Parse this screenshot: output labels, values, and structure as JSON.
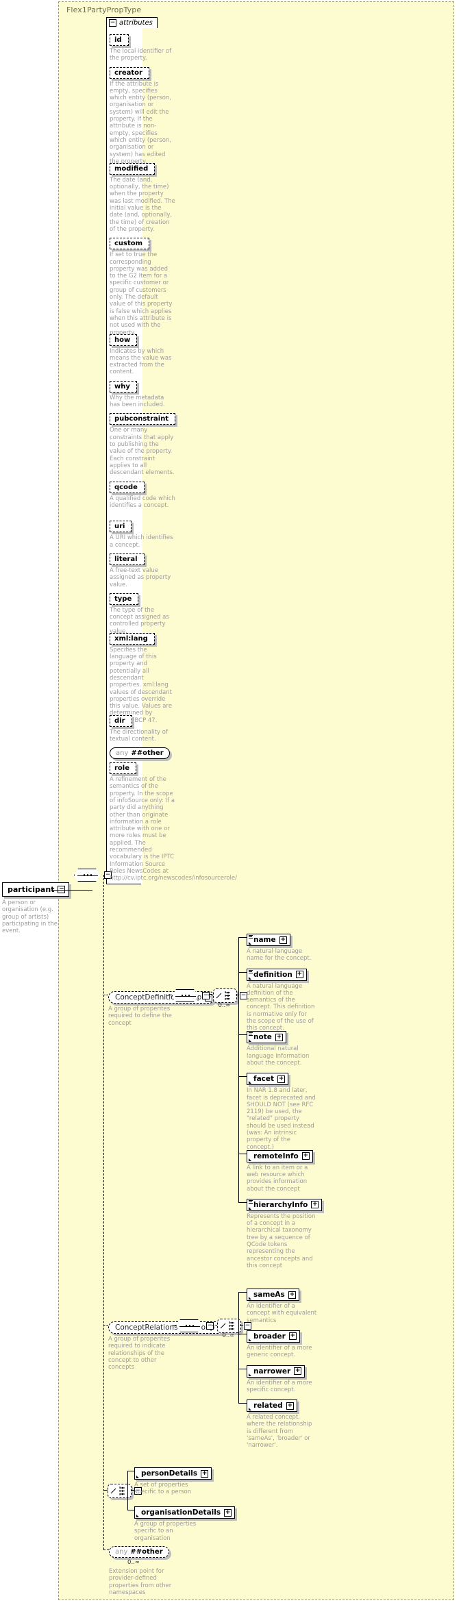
{
  "type": {
    "name": "Flex1PartyPropType",
    "attributes_label": "attributes",
    "collapse_icon": "minus-icon"
  },
  "attributes": [
    {
      "name": "id",
      "desc": "The local identifier of the property."
    },
    {
      "name": "creator",
      "desc": "If the attribute is empty, specifies which entity (person, organisation or system) will edit the property. If the attribute is non-empty, specifies which entity (person, organisation or system) has edited the property."
    },
    {
      "name": "modified",
      "desc": "The date (and, optionally, the time) when the property was last modified. The initial value is the date (and, optionally, the time) of creation of the property."
    },
    {
      "name": "custom",
      "desc": "If set to true the corresponding property was added to the G2 Item for a specific customer or group of customers only. The default value of this property is false which applies when this attribute is not used with the property."
    },
    {
      "name": "how",
      "desc": "Indicates by which means the value was extracted from the content."
    },
    {
      "name": "why",
      "desc": "Why the metadata has been included."
    },
    {
      "name": "pubconstraint",
      "desc": "One or many constraints that apply to publishing the value of the property. Each constraint applies to all descendant elements."
    },
    {
      "name": "qcode",
      "desc": "A qualified code which identifies a concept."
    },
    {
      "name": "uri",
      "desc": "A URI which identifies a concept."
    },
    {
      "name": "literal",
      "desc": "A free-text value assigned as property value."
    },
    {
      "name": "type",
      "desc": "The type of the concept assigned as controlled property value."
    },
    {
      "name": "xml:lang",
      "desc": "Specifies the language of this property and potentially all descendant properties. xml:lang values of descendant properties override this value. Values are determined by Internet BCP 47."
    },
    {
      "name": "dir",
      "desc": "The directionality of textual content."
    },
    {
      "name": "any ##other",
      "desc": "",
      "kind": "any",
      "any_prefix": "any",
      "any_value": "##other"
    },
    {
      "name": "role",
      "desc": "A refinement of the semantics of the property. In the scope of infoSource only: If a party did anything other than originate information a role attribute with one or more roles must be applied. The recommended vocabulary is the IPTC Information Source Roles NewsCodes at http://cv.iptc.org/newscodes/infosourcerole/"
    }
  ],
  "root_element": {
    "name": "participant",
    "desc": "A person or organisation (e.g. group of artists) participating in the event.",
    "toggle_icon": "minus-icon"
  },
  "groups": [
    {
      "id": "concept-definition-group",
      "name": "ConceptDefinitionGroup",
      "desc": "A group of properites required to define the concept",
      "occurrence": "0..∞",
      "children": [
        {
          "name": "name",
          "desc": "A natural language name for the concept.",
          "glyphs": [
            "lines",
            "arrow"
          ]
        },
        {
          "name": "definition",
          "desc": "A natural language definition of the semantics of the concept. This definition is normative only for the scope of the use of this concept.",
          "glyphs": [
            "lines",
            "arrow"
          ]
        },
        {
          "name": "note",
          "desc": "Additional natural language information about the concept.",
          "glyphs": [
            "lines",
            "arrow"
          ]
        },
        {
          "name": "facet",
          "desc": "In NAR 1.8 and later, facet is deprecated and SHOULD NOT (see RFC 2119) be used, the \"related\" property should be used instead (was: An intrinsic property of the concept.)",
          "glyphs": [
            "arrow"
          ]
        },
        {
          "name": "remoteInfo",
          "desc": "A link to an item or a web resource which provides information about the concept",
          "glyphs": [
            "arrow"
          ]
        },
        {
          "name": "hierarchyInfo",
          "desc": "Represents the position of a concept in a hierarchical taxonomy tree by a sequence of QCode tokens representing the ancestor concepts and this concept",
          "glyphs": [
            "lines",
            "arrow"
          ]
        }
      ]
    },
    {
      "id": "concept-relationships-group",
      "name": "ConceptRelationshipsGroup",
      "desc": "A group of properites required to indicate relationships of the concept to other concepts",
      "occurrence": "0..∞",
      "children": [
        {
          "name": "sameAs",
          "desc": "An identifier of a concept with equivalent semantics",
          "glyphs": [
            "arrow"
          ]
        },
        {
          "name": "broader",
          "desc": "An identifier of a more generic concept.",
          "glyphs": [
            "arrow"
          ]
        },
        {
          "name": "narrower",
          "desc": "An identifier of a more specific concept.",
          "glyphs": [
            "arrow"
          ]
        },
        {
          "name": "related",
          "desc": "A related concept, where the relationship is different from 'sameAs', 'broader' or 'narrower'.",
          "glyphs": [
            "arrow"
          ]
        }
      ]
    }
  ],
  "details_choice": {
    "children": [
      {
        "name": "personDetails",
        "desc": "A set of properties specific to a person",
        "glyphs": [
          "arrow"
        ]
      },
      {
        "name": "organisationDetails",
        "desc": "A group of properties specific to an organisation",
        "glyphs": [
          "arrow"
        ]
      }
    ]
  },
  "extension": {
    "any_prefix": "any",
    "any_value": "##other",
    "occurrence": "0..∞",
    "desc": "Extension point for provider-defined properties from other namespaces"
  },
  "colors": {
    "background": "#FDFBD0",
    "description_text": "#9b9b9b",
    "border": "#000000",
    "shadow": "#bdbdbd",
    "title_text": "#6d6d4b"
  }
}
